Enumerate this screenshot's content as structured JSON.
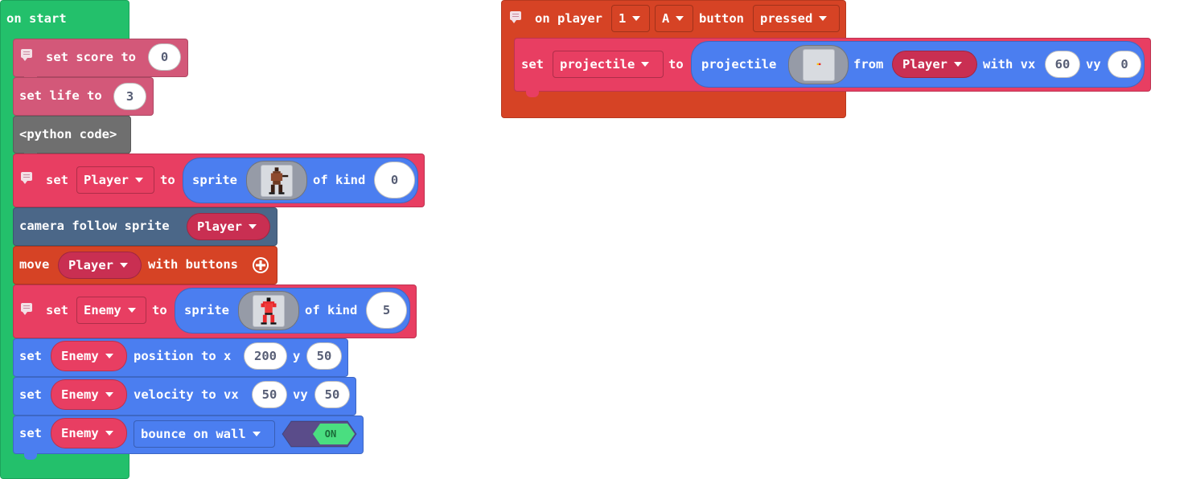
{
  "colors": {
    "loops_green": "#23c06b",
    "variables_red": "#e83e62",
    "info_pink": "#d35879",
    "python_gray": "#6f6f6f",
    "scene_blue": "#4b6788",
    "controller_orange": "#d64325",
    "sprites_blue": "#4b7ef0",
    "toggle_purple": "#5a4c8a",
    "toggle_green": "#4ade80"
  },
  "on_start": {
    "label": "on start",
    "set_score": {
      "label": "set score to",
      "value": "0"
    },
    "set_life": {
      "label": "set life to",
      "value": "3"
    },
    "python_code": "<python code>",
    "set_player": {
      "set": "set",
      "var": "Player",
      "to": "to",
      "sprite": "sprite",
      "of_kind": "of kind",
      "kind": "0",
      "image_icon": "player-sprite-image"
    },
    "camera": {
      "label": "camera follow sprite",
      "var": "Player"
    },
    "move": {
      "move": "move",
      "var": "Player",
      "with": "with buttons",
      "plus_icon": "plus-circle-icon"
    },
    "set_enemy": {
      "set": "set",
      "var": "Enemy",
      "to": "to",
      "sprite": "sprite",
      "of_kind": "of kind",
      "kind": "5",
      "image_icon": "enemy-sprite-image"
    },
    "set_position": {
      "set": "set",
      "var": "Enemy",
      "label": "position to x",
      "x": "200",
      "y_label": "y",
      "y": "50"
    },
    "set_velocity": {
      "set": "set",
      "var": "Enemy",
      "label": "velocity to vx",
      "vx": "50",
      "vy_label": "vy",
      "vy": "50"
    },
    "set_bounce": {
      "set": "set",
      "var": "Enemy",
      "option": "bounce on wall",
      "toggle": "ON"
    }
  },
  "on_button": {
    "on_player": "on player",
    "player_num": "1",
    "button_key": "A",
    "button": "button",
    "event": "pressed",
    "set_proj": {
      "set": "set",
      "var": "projectile",
      "to": "to",
      "proj": "projectile",
      "from": "from",
      "source": "Player",
      "with_vx": "with vx",
      "vx": "60",
      "vy_label": "vy",
      "vy": "0",
      "image_icon": "projectile-image"
    }
  }
}
